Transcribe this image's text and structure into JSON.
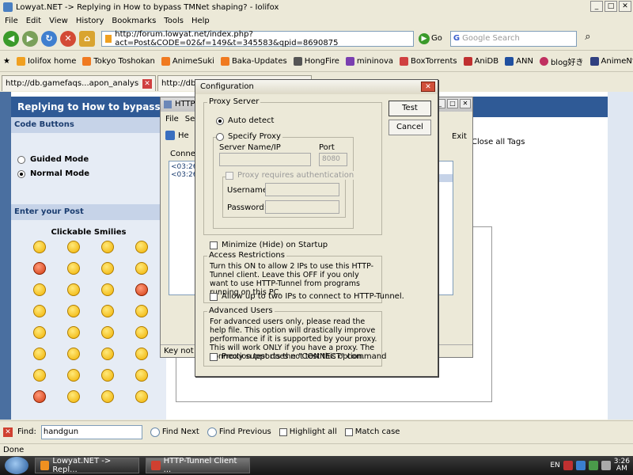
{
  "browser": {
    "title": "Lowyat.NET -> Replying in How to bypass TMNet shaping? - Iolifox",
    "menu": [
      "File",
      "Edit",
      "View",
      "History",
      "Bookmarks",
      "Tools",
      "Help"
    ],
    "url": "http://forum.lowyat.net/index.php?act=Post&CODE=02&f=149&t=345583&qpid=8690875",
    "go_label": "Go",
    "search_placeholder": "Google Search",
    "bookmarks": [
      {
        "label": "Iolifox home",
        "color": "#f0a020"
      },
      {
        "label": "Tokyo Toshokan",
        "color": "#f07a20"
      },
      {
        "label": "AnimeSuki",
        "color": "#f07a20"
      },
      {
        "label": "Baka-Updates",
        "color": "#f07a20"
      },
      {
        "label": "HongFire",
        "color": "#555555"
      },
      {
        "label": "mininova",
        "color": "#7a3fb0"
      },
      {
        "label": "BoxTorrents",
        "color": "#d04040"
      },
      {
        "label": "AniDB",
        "color": "#c03030"
      },
      {
        "label": "ANN",
        "color": "#2050a0"
      },
      {
        "label": "blog好き",
        "color": "#c03060"
      },
      {
        "label": "AnimeNfo",
        "color": "#304080"
      }
    ],
    "tabs": [
      {
        "label": "http://db.gamefaqs...apon_analysis.txt"
      },
      {
        "label": "http://db.gamefaqs...apon_analysis.txt"
      }
    ]
  },
  "page": {
    "header": "Replying to How to bypass TMNet",
    "code_buttons": "Code Buttons",
    "guided_mode": "Guided Mode",
    "normal_mode": "Normal Mode",
    "enter_post": "Enter your Post",
    "clickable_smilies": "Clickable Smilies",
    "close_all_tags": "Close all Tags"
  },
  "tunnel": {
    "title": "HTTP",
    "menu": [
      "File",
      "Set"
    ],
    "toolbar_label": "He",
    "connect_label": "Connect",
    "log": [
      "<03:26",
      "<03:26"
    ],
    "exit_label": "Exit",
    "status": "Key not fo"
  },
  "config": {
    "title": "Configuration",
    "proxy_server": "Proxy Server",
    "auto_detect": "Auto detect",
    "specify_proxy": "Specify Proxy",
    "server_name_label": "Server Name/IP",
    "port_label": "Port",
    "port_value": "8080",
    "proxy_auth": "Proxy requires authentication",
    "username_label": "Username:",
    "password_label": "Password:",
    "test_button": "Test",
    "cancel_button": "Cancel",
    "minimize_startup": "Minimize (Hide) on Startup",
    "access_restrictions": "Access Restrictions",
    "access_text": "Turn this ON to allow 2 IPs to use this HTTP-Tunnel client. Leave this OFF if you only want to use HTTP-Tunnel from programs running on this PC.",
    "allow_two_ips": "Allow up to two IPs to connect to HTTP-Tunnel.",
    "advanced_users": "Advanced Users",
    "advanced_text": "For advanced users only, please read the help file. This option will drastically improve performance if it is supported by your proxy. This will work ONLY if you have a proxy. The connection test does not test this option.",
    "connect_command": "Proxy supports the \"CONNECT\" command"
  },
  "findbar": {
    "label": "Find:",
    "value": "handgun",
    "find_next": "Find Next",
    "find_previous": "Find Previous",
    "highlight_all": "Highlight all",
    "match_case": "Match case"
  },
  "status": "Done",
  "taskbar": {
    "items": [
      "Lowyat.NET -> Repl...",
      "HTTP-Tunnel Client ..."
    ],
    "lang": "EN",
    "time": "3:26",
    "ampm": "AM"
  },
  "colors": {
    "page_header": "#2f5a96",
    "section_header": "#c6d3e8"
  }
}
